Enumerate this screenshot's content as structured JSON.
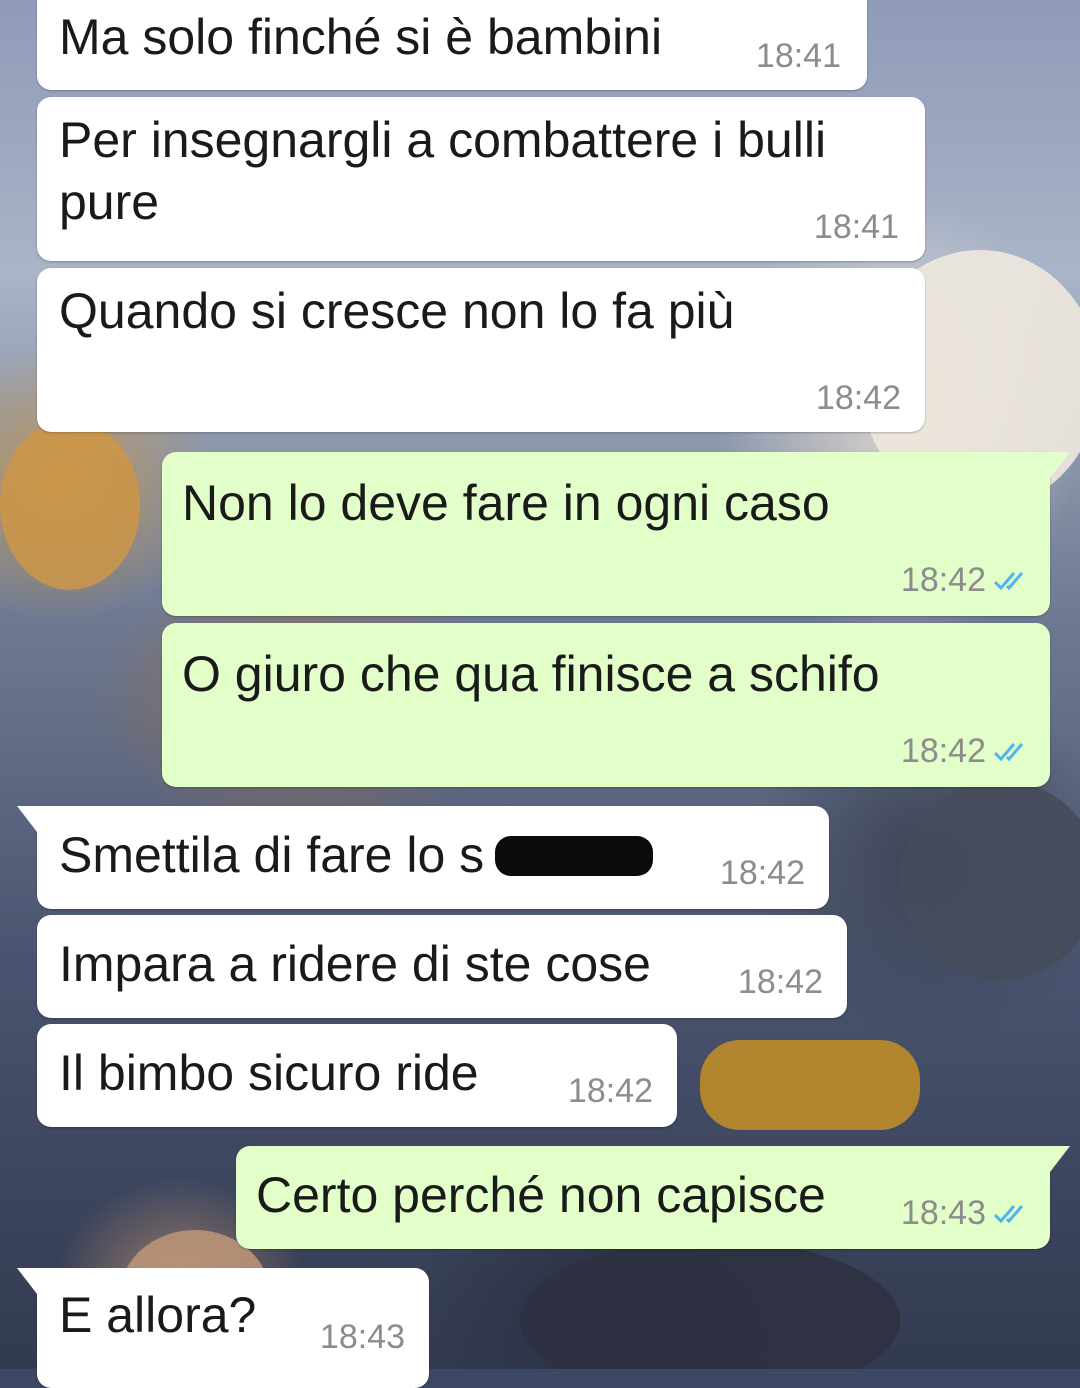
{
  "colors": {
    "incoming_bubble": "#ffffff",
    "outgoing_bubble": "#e2fec9",
    "read_ticks": "#4fb6ec",
    "timestamp": "#8c8c8c"
  },
  "messages": [
    {
      "direction": "in",
      "text": "Ma solo finché si è bambini",
      "time": "18:41"
    },
    {
      "direction": "in",
      "text": "Per insegnargli a combattere i bulli\npure",
      "time": "18:41"
    },
    {
      "direction": "in",
      "text": "Quando si cresce non lo fa più",
      "time": "18:42"
    },
    {
      "direction": "out",
      "text": "Non lo deve fare in ogni caso",
      "time": "18:42",
      "status_icon": "double-check-read-icon"
    },
    {
      "direction": "out",
      "text": "O giuro che qua finisce a schifo",
      "time": "18:42",
      "status_icon": "double-check-read-icon"
    },
    {
      "direction": "in",
      "text": "Smettila di fare lo s",
      "time": "18:42",
      "redacted": true
    },
    {
      "direction": "in",
      "text": "Impara a ridere di ste cose",
      "time": "18:42"
    },
    {
      "direction": "in",
      "text": "Il bimbo sicuro ride",
      "time": "18:42"
    },
    {
      "direction": "out",
      "text": "Certo perché non capisce",
      "time": "18:43",
      "status_icon": "double-check-read-icon"
    },
    {
      "direction": "in",
      "text": "E allora?",
      "time": "18:43"
    }
  ]
}
